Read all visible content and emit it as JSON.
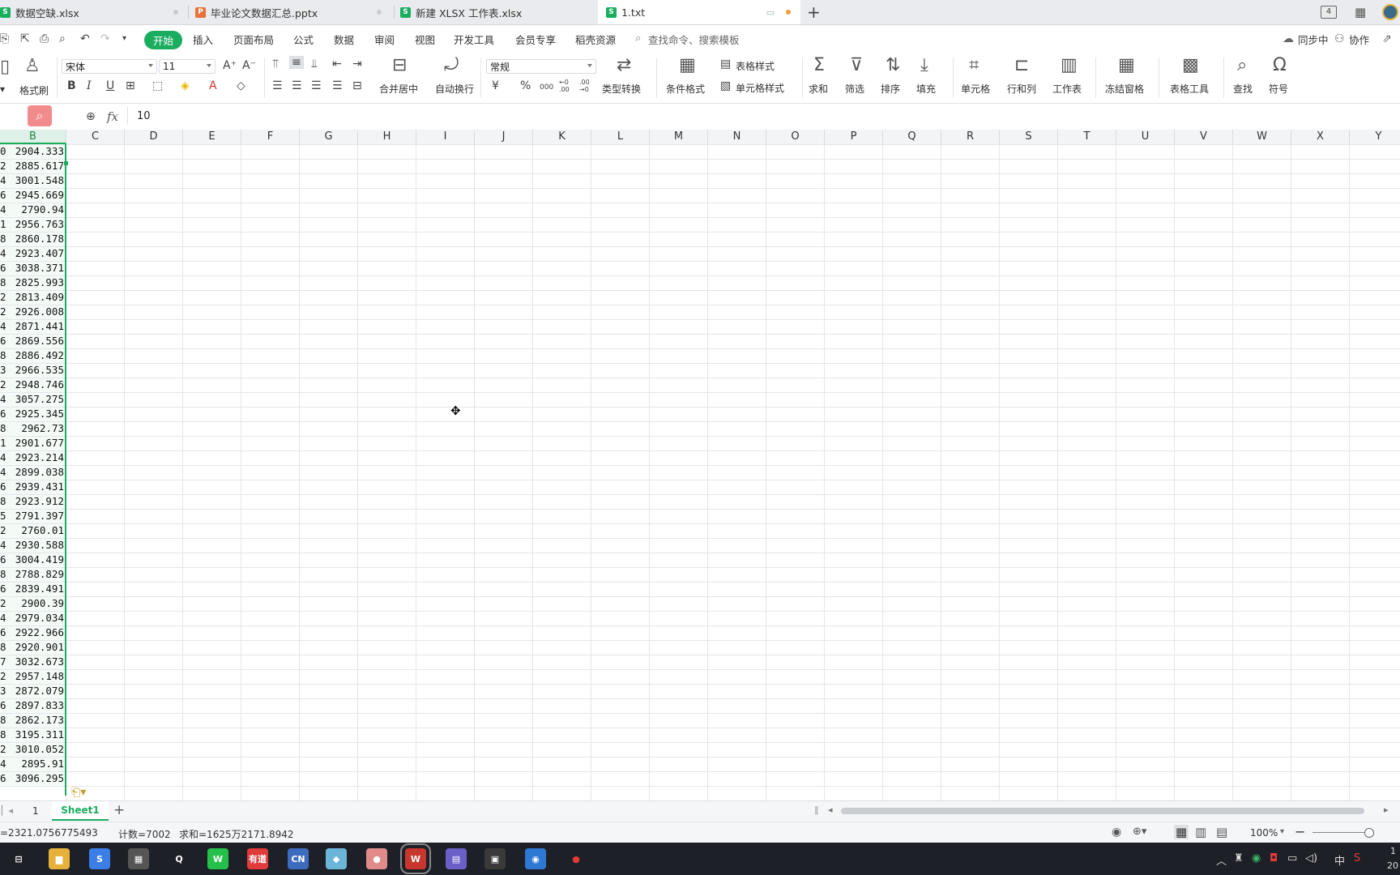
{
  "tabs": [
    {
      "label": "数据空缺.xlsx",
      "icon": "S",
      "color": "#1aad60"
    },
    {
      "label": "毕业论文数据汇总.pptx",
      "icon": "P",
      "color": "#e8713a"
    },
    {
      "label": "新建 XLSX 工作表.xlsx",
      "icon": "S",
      "color": "#1aad60"
    },
    {
      "label": "1.txt",
      "icon": "S",
      "color": "#1aad60"
    }
  ],
  "new_tab": "+",
  "tab_counter": "4",
  "menus": [
    "开始",
    "插入",
    "页面布局",
    "公式",
    "数据",
    "审阅",
    "视图",
    "开发工具",
    "会员专享",
    "稻壳资源"
  ],
  "search_placeholder": "查找命令、搜索模板",
  "sync": "同步中",
  "collab": "协作",
  "ribbon": {
    "format_painter": "格式刷",
    "font_name": "宋体",
    "font_size": "11",
    "merge_center": "合并居中",
    "wrap_text": "自动换行",
    "number_format": "常规",
    "type_convert": "类型转换",
    "table_style": "表格样式",
    "cond_format": "条件格式",
    "cell_style": "单元格样式",
    "sum": "求和",
    "filter": "筛选",
    "sort": "排序",
    "fill": "填充",
    "cell": "单元格",
    "row_col": "行和列",
    "worksheet": "工作表",
    "freeze": "冻结窗格",
    "table_tools": "表格工具",
    "find": "查找",
    "symbol": "符号",
    "currency": "¥",
    "percent": "%",
    "thousands": "000",
    "dec_inc": "←0 .00",
    "dec_dec": ".00 →0"
  },
  "formula": {
    "fx": "fx",
    "value": "10"
  },
  "columns": [
    "B",
    "C",
    "D",
    "E",
    "F",
    "G",
    "H",
    "I",
    "J",
    "K",
    "L",
    "M",
    "N",
    "O",
    "P",
    "Q",
    "R",
    "S",
    "T",
    "U",
    "V",
    "W",
    "X",
    "Y"
  ],
  "colA_tail": [
    "0",
    "2",
    "4",
    "6",
    "4",
    "1",
    "8",
    "4",
    "6",
    "8",
    "2",
    "2",
    "4",
    "6",
    "8",
    "3",
    "2",
    "4",
    "6",
    "8",
    "1",
    "4",
    "4",
    "6",
    "8",
    "5",
    "2",
    "4",
    "6",
    "8",
    "6",
    "2",
    "4",
    "6",
    "8",
    "7",
    "2",
    "3",
    "6",
    "8",
    "8",
    "2",
    "4",
    "6"
  ],
  "colB": [
    "2904.333",
    "2885.617",
    "3001.548",
    "2945.669",
    "2790.94",
    "2956.763",
    "2860.178",
    "2923.407",
    "3038.371",
    "2825.993",
    "2813.409",
    "2926.008",
    "2871.441",
    "2869.556",
    "2886.492",
    "2966.535",
    "2948.746",
    "3057.275",
    "2925.345",
    "2962.73",
    "2901.677",
    "2923.214",
    "2899.038",
    "2939.431",
    "2923.912",
    "2791.397",
    "2760.01",
    "2930.588",
    "3004.419",
    "2788.829",
    "2839.491",
    "2900.39",
    "2979.034",
    "2922.966",
    "2920.901",
    "3032.673",
    "2957.148",
    "2872.079",
    "2897.833",
    "2862.173",
    "3195.311",
    "3010.052",
    "2895.91",
    "3096.295"
  ],
  "sheet_nav": "1",
  "sheet_name": "Sheet1",
  "status": {
    "average": "=2321.0756775493",
    "count": "计数=7002",
    "sum": "求和=1625万2171.8942",
    "zoom": "100%"
  },
  "taskbar_items": [
    {
      "name": "task-view",
      "label": "⊟",
      "color": "#1d2026"
    },
    {
      "name": "file-explorer",
      "label": "▆",
      "color": "#e6b13a"
    },
    {
      "name": "sogou",
      "label": "S",
      "color": "#3b7ee8"
    },
    {
      "name": "calculator",
      "label": "▦",
      "color": "#555"
    },
    {
      "name": "qq",
      "label": "Q",
      "color": "#1d2026"
    },
    {
      "name": "wechat",
      "label": "W",
      "color": "#25c04a"
    },
    {
      "name": "youdao",
      "label": "有道",
      "color": "#e03a3a"
    },
    {
      "name": "cnki",
      "label": "CN",
      "color": "#3d6bbd"
    },
    {
      "name": "notes",
      "label": "◆",
      "color": "#6bb6d8"
    },
    {
      "name": "app-pink",
      "label": "●",
      "color": "#e08a8a"
    },
    {
      "name": "wps",
      "label": "W",
      "color": "#c8372d"
    },
    {
      "name": "app-book",
      "label": "▤",
      "color": "#6a5fc7"
    },
    {
      "name": "app-dark",
      "label": "▣",
      "color": "#3a3a3a"
    },
    {
      "name": "app-globe",
      "label": "◉",
      "color": "#2d78d3"
    },
    {
      "name": "recorder",
      "label": "●",
      "color": "#1d2026"
    }
  ],
  "tray": {
    "ime": "中",
    "time": "1",
    "date": "20"
  }
}
